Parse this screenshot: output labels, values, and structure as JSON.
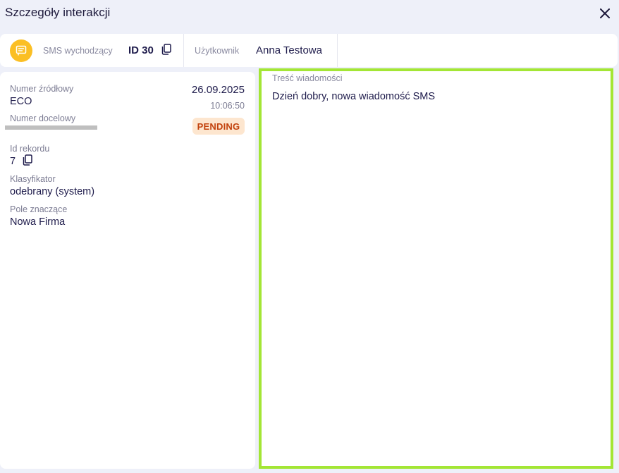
{
  "window": {
    "title": "Szczegóły interakcji",
    "close_icon": "close-icon"
  },
  "info_bar": {
    "type_icon": "sms-icon",
    "type_label": "SMS wychodzący",
    "id_label": "ID 30",
    "copy_icon": "copy-icon",
    "user_label": "Użytkownik",
    "user_value": "Anna Testowa",
    "accent_color": "#fbbf24"
  },
  "details": {
    "source_number_label": "Numer źródłowy",
    "source_number_value": "ECO",
    "target_number_label": "Numer docelowy",
    "target_number_masked": true,
    "date": "26.09.2025",
    "time": "10:06:50",
    "status": "PENDING",
    "status_color": "#c2410c",
    "record_id_label": "Id rekordu",
    "record_id_value": "7",
    "classifier_label": "Klasyfikator",
    "classifier_value": "odebrany (system)",
    "significant_field_label": "Pole znaczące",
    "significant_field_value": "Nowa Firma"
  },
  "message": {
    "label": "Treść wiadomości",
    "body": "Dzień dobry, nowa wiadomość SMS",
    "highlight_color": "#a3e635"
  }
}
